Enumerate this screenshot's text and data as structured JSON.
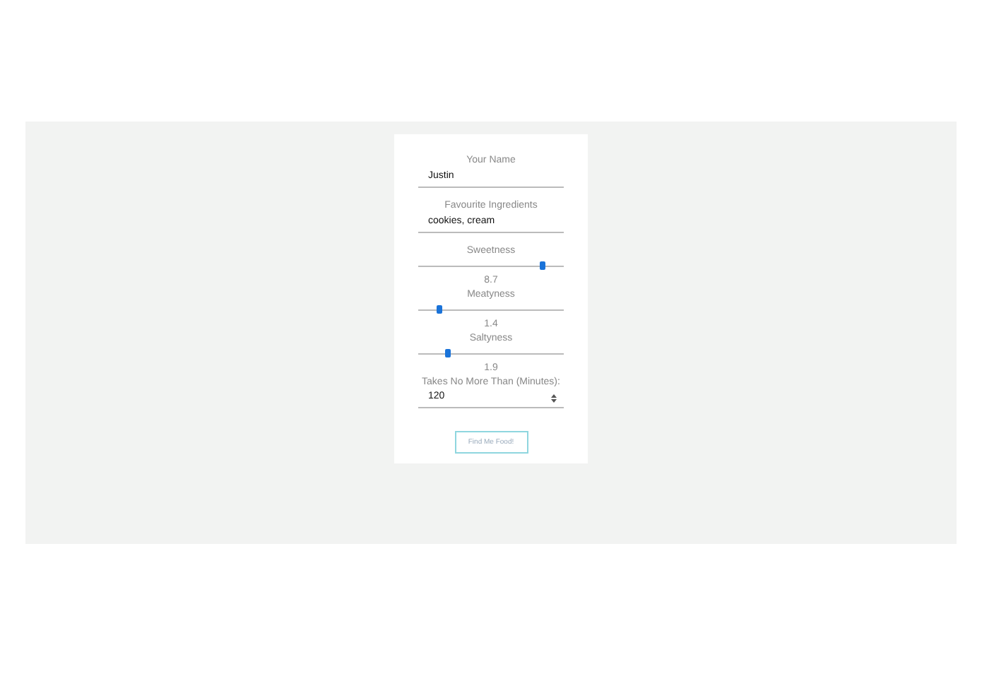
{
  "fields": [
    {
      "kind": "text",
      "label": "Your Name",
      "value": "Justin"
    },
    {
      "kind": "text",
      "label": "Favourite Ingredients",
      "value": "cookies, cream"
    },
    {
      "kind": "slider",
      "label": "Sweetness",
      "level": 0.85,
      "reading": "8.7"
    },
    {
      "kind": "slider",
      "label": "Meatyness",
      "level": 0.15,
      "reading": "1.4"
    },
    {
      "kind": "slider",
      "label": "Saltyness",
      "level": 0.2,
      "reading": "1.9"
    },
    {
      "kind": "number",
      "label": "Takes No More Than (Minutes):",
      "value": "120"
    }
  ],
  "button": "Find Me Food!"
}
